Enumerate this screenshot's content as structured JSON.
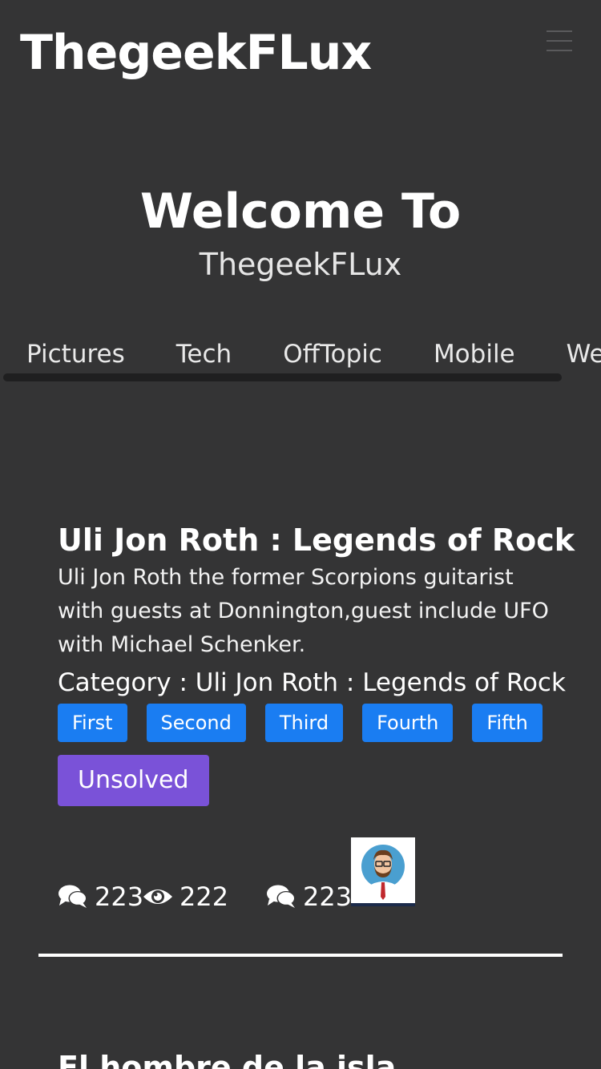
{
  "header": {
    "brand": "ThegeekFLux"
  },
  "hero": {
    "title": "Welcome To",
    "subtitle": "ThegeekFLux"
  },
  "tabs": [
    "Pictures",
    "Tech",
    "OffTopic",
    "Mobile",
    "Web"
  ],
  "post": {
    "title": "Uli Jon Roth : Legends of Rock",
    "description": "Uli Jon Roth the former Scorpions guitarist with guests at Donnington,guest include UFO with Michael Schenker.",
    "category_label": "Category : Uli Jon Roth : Legends of Rock",
    "tags": [
      "First",
      "Second",
      "Third",
      "Fourth",
      "Fifth"
    ],
    "status": "Unsolved",
    "comments_count": "223",
    "views_count": "222",
    "replies_count": "223"
  },
  "next_post": {
    "title": "El hombre de la isla"
  },
  "colors": {
    "background": "#343435",
    "tag": "#1a7df2",
    "status": "#7a52d8"
  },
  "icons": {
    "comments": "comments-icon",
    "views": "eye-icon",
    "menu": "hamburger-menu-icon"
  }
}
